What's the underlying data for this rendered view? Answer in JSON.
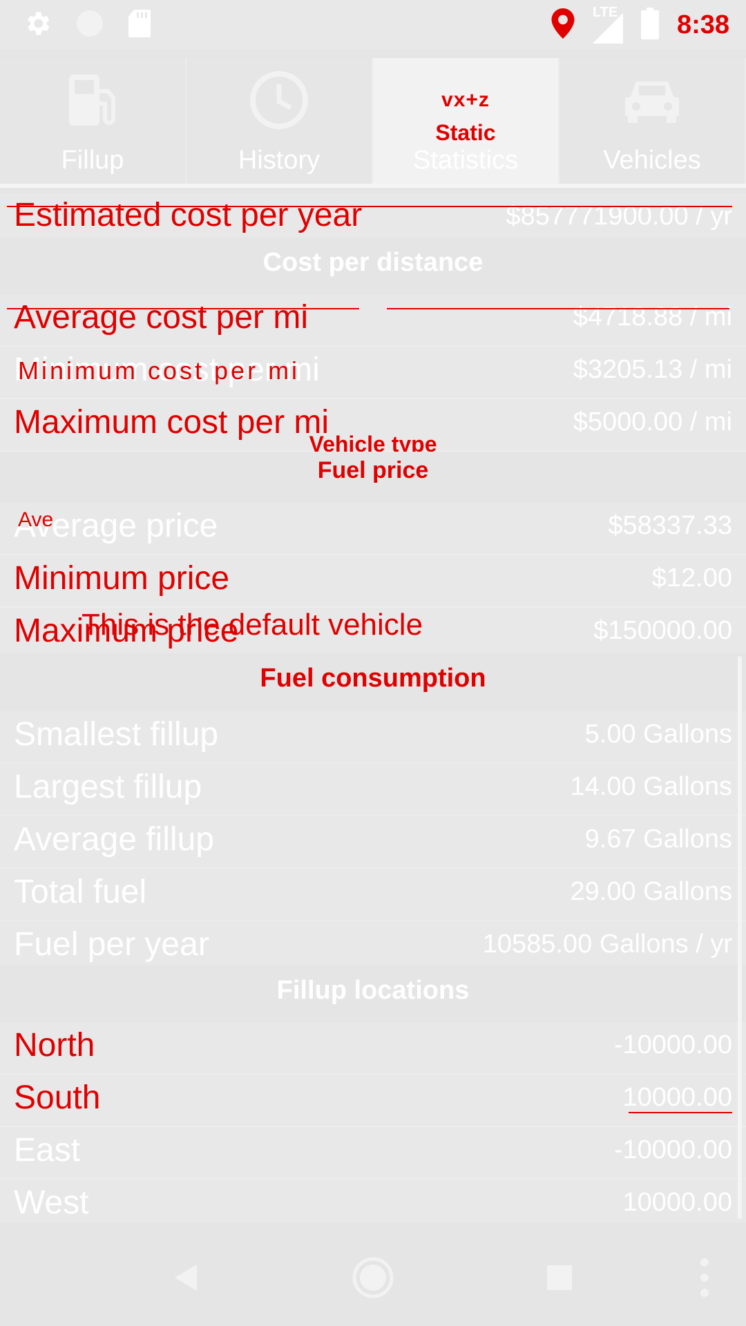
{
  "status_bar": {
    "time": "8:38",
    "network": "LTE",
    "icons": [
      "settings-icon",
      "circle-icon",
      "sd-card-icon",
      "location-pin-icon",
      "signal-icon",
      "battery-icon"
    ],
    "accent_color": "#e00000"
  },
  "tabs": [
    {
      "label": "Fillup",
      "icon": "fuel-pump-icon",
      "active": false
    },
    {
      "label": "History",
      "icon": "clock-icon",
      "active": false
    },
    {
      "label": "Statistics",
      "icon": "statistics-glyph",
      "active": true,
      "glyph": "vx+z",
      "overlay_label": "Static"
    },
    {
      "label": "Vehicles",
      "icon": "car-icon",
      "active": false
    }
  ],
  "rows": {
    "estimated_cost_per_year": {
      "label": "Estimated cost per year",
      "value": "$857771900.00 / yr"
    },
    "avg_cost_per_distance": {
      "label": "Average cost per mi",
      "value": "$4718.88 / mi"
    },
    "min_cost_per_distance": {
      "label": "Minimum cost per mi",
      "value": "$3205.13 / mi",
      "overlay": "Minimum cost per mi"
    },
    "max_cost_per_distance": {
      "label": "Maximum cost per mi",
      "value": "$5000.00 / mi"
    },
    "avg_price": {
      "label": "Average price",
      "value": "$58337.33",
      "overlay": "Ave"
    },
    "min_price": {
      "label": "Minimum price",
      "value": "$12.00"
    },
    "max_price": {
      "label": "Maximum price",
      "value": "$150000.00"
    },
    "smallest_fillup": {
      "label": "Smallest fillup",
      "value": "5.00 Gallons"
    },
    "largest_fillup": {
      "label": "Largest fillup",
      "value": "14.00 Gallons"
    },
    "average_fillup": {
      "label": "Average fillup",
      "value": "9.67 Gallons"
    },
    "total_fuel": {
      "label": "Total fuel",
      "value": "29.00 Gallons"
    },
    "fuel_per_year": {
      "label": "Fuel per year",
      "value": "10585.00 Gallons / yr"
    },
    "north": {
      "label": "North",
      "value": "-10000.00"
    },
    "south": {
      "label": "South",
      "value": "10000.00"
    },
    "east": {
      "label": "East",
      "value": "-10000.00"
    },
    "west": {
      "label": "West",
      "value": "10000.00"
    }
  },
  "sections": {
    "cost_per_distance": "Cost per distance",
    "fuel_price": "Fuel price",
    "vehicle_type": "Vehicle type",
    "fuel_consumption": "Fuel consumption",
    "fillup_locations": "Fillup locations"
  },
  "overlays": {
    "default_vehicle": "This is the default vehicle"
  },
  "nav_bar": {
    "icons": [
      "back-icon",
      "home-icon",
      "recents-icon",
      "overflow-menu-icon"
    ]
  }
}
